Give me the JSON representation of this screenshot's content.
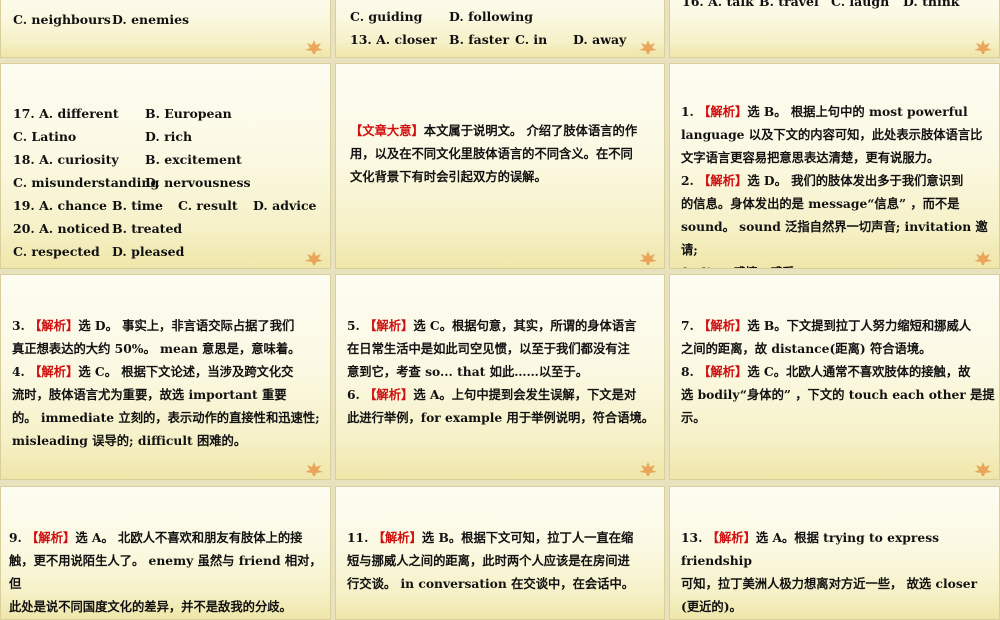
{
  "panels": {
    "p1": {
      "lines": [
        "C. neighbours",
        "D. enemies"
      ]
    },
    "p2": {
      "lines": [
        "C. guiding",
        "D. following",
        "13. A. closer",
        "B. faster",
        "C. in",
        "D. away"
      ]
    },
    "p3": {
      "lines": [
        "16. A. talk",
        "B. travel",
        "C. laugh",
        "D. think"
      ]
    },
    "p4": {
      "rows": [
        [
          "17. A. different",
          "B. European"
        ],
        [
          "C. Latino",
          "D. rich"
        ],
        [
          "18. A. curiosity",
          "B. excitement"
        ],
        [
          "C. misunderstanding",
          "D. nervousness"
        ],
        [
          "19. A. chance",
          "B. time",
          "C. result",
          "D. advice"
        ],
        [
          "20. A. noticed",
          "B. treated"
        ],
        [
          "C. respected",
          "D. pleased"
        ]
      ]
    },
    "p5": {
      "tag": "【文章大意】",
      "lines": [
        "本文属于说明文。 介绍了肢体语言的作",
        "用，以及在不同文化里肢体语言的不同含义。在不同",
        "文化背景下有时会引起双方的误解。"
      ]
    },
    "p6": {
      "tag": "【解析】",
      "lines": [
        [
          "1. ",
          "【解析】",
          "选 B。 根据上句中的 most powerful"
        ],
        [
          "",
          "",
          "language 以及下文的内容可知，此处表示肢体语言比"
        ],
        [
          "",
          "",
          "文字语言更容易把意思表达清楚，更有说服力。"
        ],
        [
          "2. ",
          "【解析】",
          "选 D。 我们的肢体发出多于我们意识到"
        ],
        [
          "",
          "",
          "的信息。身体发出的是 message“信息” ，而不是"
        ],
        [
          "",
          "",
          "sound。 sound 泛指自然界一切声音; invitation 邀请;"
        ],
        [
          "",
          "",
          "feeling 感情，感受。"
        ]
      ]
    },
    "p7": {
      "lines": [
        [
          "3. ",
          "【解析】",
          "选 D。 事实上，非言语交际占据了我们"
        ],
        [
          "",
          "",
          "真正想表达的大约 50%。 mean 意思是，意味着。"
        ],
        [
          "4. ",
          "【解析】",
          "选 C。 根据下文论述，当涉及跨文化交"
        ],
        [
          "",
          "",
          "流时，肢体语言尤为重要，故选 important 重要"
        ],
        [
          "",
          "",
          "的。 immediate 立刻的，表示动作的直接性和迅速性;"
        ],
        [
          "",
          "",
          "misleading 误导的; difficult 困难的。"
        ]
      ]
    },
    "p8": {
      "lines": [
        [
          "5. ",
          "【解析】",
          "选 C。根据句意，其实，所谓的身体语言"
        ],
        [
          "",
          "",
          "在日常生活中是如此司空见惯，以至于我们都没有注"
        ],
        [
          "",
          "",
          "意到它，考查 so... that 如此……以至于。"
        ],
        [
          "6. ",
          "【解析】",
          "选 A。上句中提到会发生误解，下文是对"
        ],
        [
          "",
          "",
          "此进行举例，for example 用于举例说明，符合语境。"
        ]
      ]
    },
    "p9": {
      "lines": [
        [
          "7. ",
          "【解析】",
          "选 B。下文提到拉丁人努力缩短和挪威人"
        ],
        [
          "",
          "",
          "之间的距离，故 distance(距离) 符合语境。"
        ],
        [
          "8. ",
          "【解析】",
          "选 C。北欧人通常不喜欢肢体的接触，故"
        ],
        [
          "",
          "",
          "选 bodily“身体的” ，下文的 touch each other 是提示。"
        ]
      ]
    },
    "p10": {
      "lines": [
        [
          "9. ",
          "【解析】",
          "选 A。 北欧人不喜欢和朋友有肢体上的接"
        ],
        [
          "",
          "",
          "触，更不用说陌生人了。 enemy 虽然与 friend 相对，但"
        ],
        [
          "",
          "",
          "此处是说不同国度文化的差异，并不是敌我的分歧。"
        ]
      ]
    },
    "p11": {
      "lines": [
        [
          "11. ",
          "【解析】",
          "选 B。根据下文可知，拉丁人一直在缩"
        ],
        [
          "",
          "",
          "短与挪威人之间的距离，此时两个人应该是在房间进"
        ],
        [
          "",
          "",
          "行交谈。 in conversation 在交谈中，在会话中。"
        ]
      ]
    },
    "p12": {
      "lines": [
        [
          "13. ",
          "【解析】",
          "选 A。根据 trying to express friendship"
        ],
        [
          "",
          "",
          "可知，拉丁美洲人极力想离对方近一些， 故选 closer"
        ],
        [
          "",
          "",
          "(更近的)。"
        ]
      ]
    }
  },
  "colors": {
    "accent_red": "#d01010",
    "panel_bg": "#fbf9e3",
    "page_bg": "#e9e2bf"
  },
  "icons": {
    "corner": "maple-leaf-icon"
  }
}
